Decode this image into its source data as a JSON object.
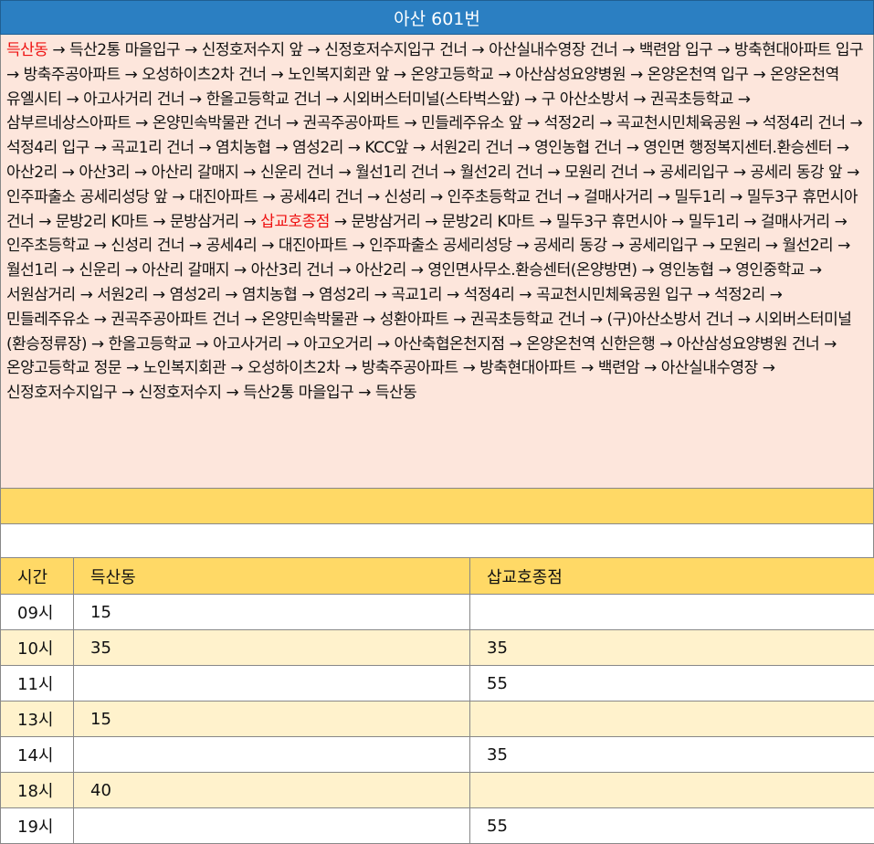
{
  "title": "아산 601번",
  "route": {
    "arrow": "→",
    "highlight_color": "#ee1111",
    "stops": [
      {
        "name": "득산동",
        "highlight": true
      },
      {
        "name": "득산2통 마을입구"
      },
      {
        "name": "신정호저수지 앞"
      },
      {
        "name": "신정호저수지입구 건너"
      },
      {
        "name": "아산실내수영장 건너"
      },
      {
        "name": "백련암 입구"
      },
      {
        "name": "방축현대아파트 입구"
      },
      {
        "name": "방축주공아파트"
      },
      {
        "name": "오성하이츠2차 건너"
      },
      {
        "name": "노인복지회관 앞"
      },
      {
        "name": "온양고등학교"
      },
      {
        "name": "아산삼성요양병원"
      },
      {
        "name": "온양온천역 입구"
      },
      {
        "name": "온양온천역 유엘시티"
      },
      {
        "name": "아고사거리 건너"
      },
      {
        "name": "한올고등학교 건너"
      },
      {
        "name": "시외버스터미널(스타벅스앞)"
      },
      {
        "name": "구 아산소방서"
      },
      {
        "name": "권곡초등학교"
      },
      {
        "name": "삼부르네상스아파트"
      },
      {
        "name": "온양민속박물관 건너"
      },
      {
        "name": "권곡주공아파트"
      },
      {
        "name": "민들레주유소 앞"
      },
      {
        "name": "석정2리"
      },
      {
        "name": "곡교천시민체육공원"
      },
      {
        "name": "석정4리 건너"
      },
      {
        "name": "석정4리 입구"
      },
      {
        "name": "곡교1리 건너"
      },
      {
        "name": "염치농협"
      },
      {
        "name": "염성2리"
      },
      {
        "name": "KCC앞"
      },
      {
        "name": "서원2리 건너"
      },
      {
        "name": "영인농협 건너"
      },
      {
        "name": "영인면 행정복지센터.환승센터"
      },
      {
        "name": "아산2리"
      },
      {
        "name": "아산3리"
      },
      {
        "name": "아산리 갈매지"
      },
      {
        "name": "신운리 건너"
      },
      {
        "name": "월선1리 건너"
      },
      {
        "name": "월선2리 건너"
      },
      {
        "name": "모원리 건너"
      },
      {
        "name": "공세리입구"
      },
      {
        "name": "공세리 동강 앞"
      },
      {
        "name": "인주파출소 공세리성당 앞"
      },
      {
        "name": "대진아파트"
      },
      {
        "name": "공세4리 건너"
      },
      {
        "name": "신성리"
      },
      {
        "name": "인주초등학교 건너"
      },
      {
        "name": "걸매사거리"
      },
      {
        "name": "밀두1리"
      },
      {
        "name": "밀두3구 휴먼시아 건너"
      },
      {
        "name": "문방2리 K마트"
      },
      {
        "name": "문방삼거리"
      },
      {
        "name": "삽교호종점",
        "highlight": true
      },
      {
        "name": "문방삼거리"
      },
      {
        "name": "문방2리 K마트"
      },
      {
        "name": "밀두3구 휴먼시아"
      },
      {
        "name": "밀두1리"
      },
      {
        "name": "걸매사거리"
      },
      {
        "name": "인주초등학교"
      },
      {
        "name": "신성리 건너"
      },
      {
        "name": "공세4리"
      },
      {
        "name": "대진아파트"
      },
      {
        "name": "인주파출소 공세리성당"
      },
      {
        "name": "공세리 동강"
      },
      {
        "name": "공세리입구"
      },
      {
        "name": "모원리"
      },
      {
        "name": "월선2리"
      },
      {
        "name": "월선1리"
      },
      {
        "name": "신운리"
      },
      {
        "name": "아산리 갈매지"
      },
      {
        "name": "아산3리 건너"
      },
      {
        "name": "아산2리"
      },
      {
        "name": "영인면사무소.환승센터(온양방면)"
      },
      {
        "name": "영인농협"
      },
      {
        "name": "영인중학교"
      },
      {
        "name": "서원삼거리"
      },
      {
        "name": "서원2리"
      },
      {
        "name": "염성2리"
      },
      {
        "name": "염치농협"
      },
      {
        "name": "염성2리"
      },
      {
        "name": "곡교1리"
      },
      {
        "name": "석정4리"
      },
      {
        "name": "곡교천시민체육공원 입구"
      },
      {
        "name": "석정2리"
      },
      {
        "name": "민들레주유소"
      },
      {
        "name": "권곡주공아파트 건너"
      },
      {
        "name": "온양민속박물관"
      },
      {
        "name": "성환아파트"
      },
      {
        "name": "권곡초등학교 건너"
      },
      {
        "name": "(구)아산소방서 건너"
      },
      {
        "name": "시외버스터미널(환승정류장)"
      },
      {
        "name": "한올고등학교"
      },
      {
        "name": "아고사거리"
      },
      {
        "name": "아고오거리"
      },
      {
        "name": "아산축협온천지점"
      },
      {
        "name": "온양온천역 신한은행"
      },
      {
        "name": "아산삼성요양병원 건너"
      },
      {
        "name": "온양고등학교 정문"
      },
      {
        "name": "노인복지회관"
      },
      {
        "name": "오성하이츠2차"
      },
      {
        "name": "방축주공아파트"
      },
      {
        "name": "방축현대아파트"
      },
      {
        "name": "백련암"
      },
      {
        "name": "아산실내수영장"
      },
      {
        "name": "신정호저수지입구"
      },
      {
        "name": "신정호저수지"
      },
      {
        "name": "득산2통 마을입구"
      },
      {
        "name": "득산동"
      }
    ]
  },
  "timetable": {
    "headers": [
      "시간",
      "득산동",
      "삽교호종점"
    ],
    "rows": [
      [
        "09시",
        "15",
        ""
      ],
      [
        "10시",
        "35",
        "35"
      ],
      [
        "11시",
        "",
        "55"
      ],
      [
        "13시",
        "15",
        ""
      ],
      [
        "14시",
        "",
        "35"
      ],
      [
        "18시",
        "40",
        ""
      ],
      [
        "19시",
        "",
        "55"
      ]
    ]
  }
}
